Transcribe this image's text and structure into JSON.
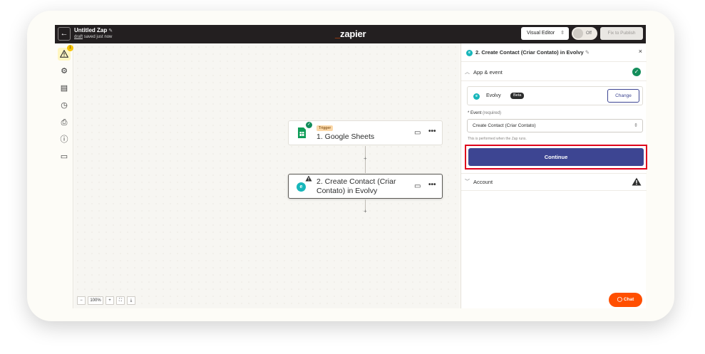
{
  "header": {
    "back_icon": "←",
    "zap_title": "Untitled Zap",
    "edit_icon": "✎",
    "status_draft": "draft",
    "status_saved": "saved just now",
    "logo_prefix": "_",
    "logo_word": "zapier",
    "editor_mode": "Visual Editor",
    "toggle_label": "Off",
    "publish_label": "Fix to Publish"
  },
  "sidebar": {
    "warning_count": "1",
    "icons": [
      "warning-icon",
      "gear-icon",
      "layers-icon",
      "history-icon",
      "file-export-icon",
      "help-icon",
      "comment-icon"
    ]
  },
  "canvas": {
    "trigger_step": {
      "tag": "Trigger",
      "title": "1. Google Sheets"
    },
    "action_step": {
      "title_line1": "2. Create Contact (Criar",
      "title_line2": "Contato) in Evolvy"
    },
    "plus": "+",
    "zoom": {
      "minus": "−",
      "level": "100%",
      "plus": "+",
      "fit": "⛶",
      "download": "⤓"
    }
  },
  "panel": {
    "title": "2. Create Contact (Criar Contato) in Evolvy",
    "close_icon": "×",
    "app_event_label": "App & event",
    "app_name": "Evolvy",
    "app_badge": "Beta",
    "change_label": "Change",
    "event_label": "Event",
    "event_required": "(required)",
    "event_value": "Create Contact (Criar Contato)",
    "event_help": "This is performed when the Zap runs.",
    "continue_label": "Continue",
    "account_label": "Account"
  },
  "chat": {
    "label": "Chat"
  },
  "colors": {
    "brand_orange": "#ff4f00",
    "primary_button": "#3d4592",
    "highlight_red": "#e0001b",
    "success_green": "#138d5b"
  }
}
